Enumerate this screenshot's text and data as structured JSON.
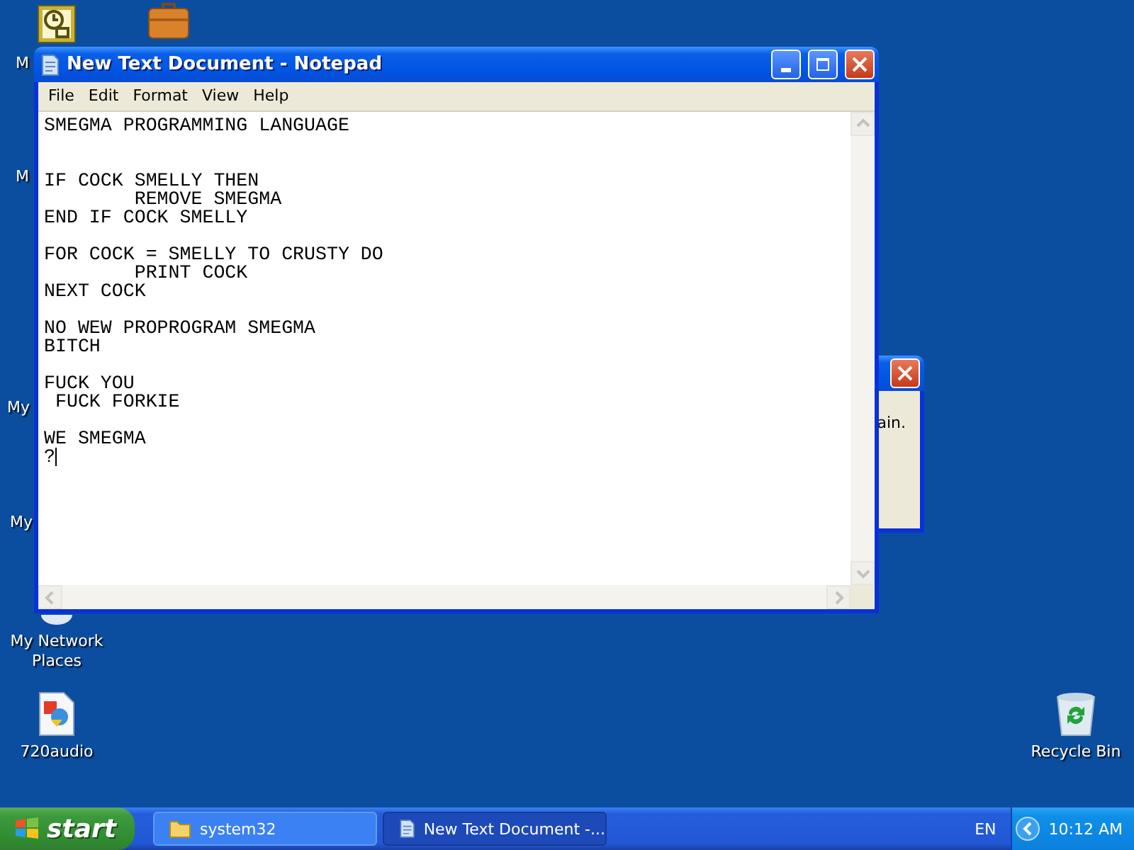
{
  "desktop": {
    "icons": [
      {
        "kind": "calendar"
      },
      {
        "kind": "briefcase"
      },
      {
        "kind": "network",
        "label": "My Network Places"
      },
      {
        "kind": "document",
        "label": "720audio"
      },
      {
        "kind": "recycle",
        "label": "Recycle Bin"
      }
    ],
    "cut_labels": [
      "M",
      "M",
      "My",
      "My"
    ]
  },
  "dialog_behind": {
    "text": "ain."
  },
  "notepad": {
    "title": "New Text Document - Notepad",
    "menu": [
      "File",
      "Edit",
      "Format",
      "View",
      "Help"
    ],
    "content": "SMEGMA PROGRAMMING LANGUAGE\n\n\nIF COCK SMELLY THEN\n        REMOVE SMEGMA\nEND IF COCK SMELLY\n\nFOR COCK = SMELLY TO CRUSTY DO\n        PRINT COCK\nNEXT COCK\n\nNO WEW PROPROGRAM SMEGMA\nBITCH\n\nFUCK YOU\n FUCK FORKIE\n\nWE SMEGMA\n?"
  },
  "taskbar": {
    "start": "start",
    "tasks": [
      {
        "label": "system32",
        "kind": "folder",
        "selected": false
      },
      {
        "label": "New Text Document -...",
        "kind": "notepad",
        "selected": true
      }
    ],
    "language": "EN",
    "clock": "10:12 AM"
  }
}
